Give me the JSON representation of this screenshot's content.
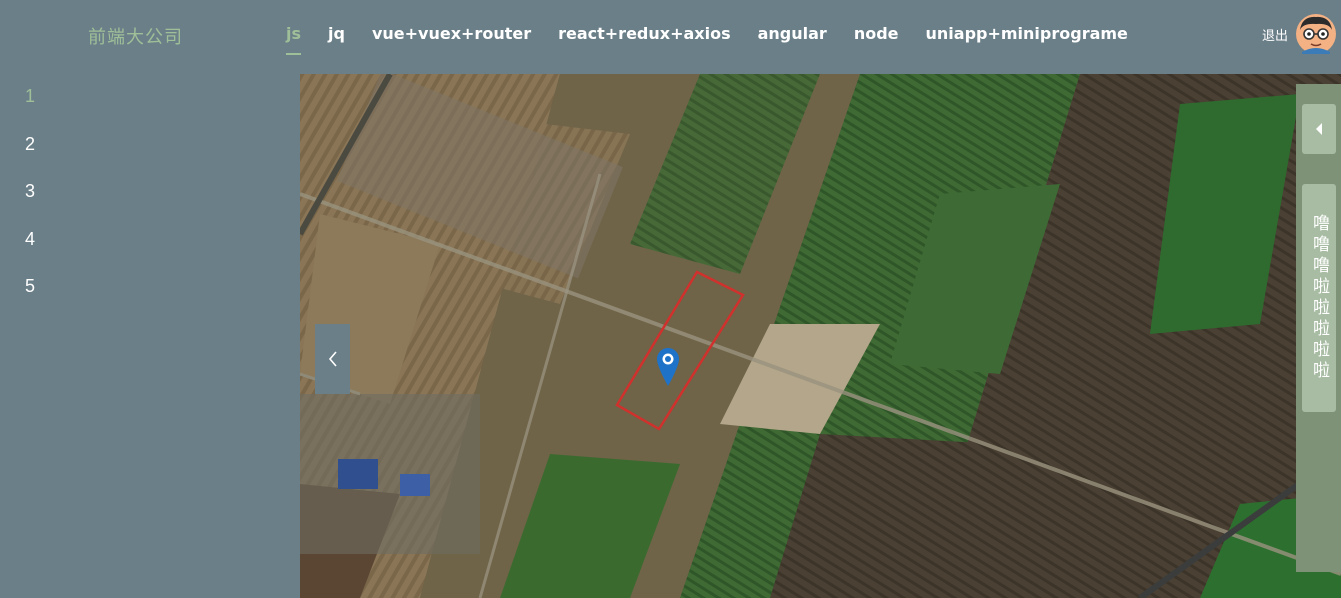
{
  "header": {
    "brand": "前端大公司",
    "nav": [
      {
        "label": "js",
        "active": true
      },
      {
        "label": "jq"
      },
      {
        "label": "vue+vuex+router"
      },
      {
        "label": "react+redux+axios"
      },
      {
        "label": "angular"
      },
      {
        "label": "node"
      },
      {
        "label": "uniapp+miniprograme"
      }
    ],
    "logout": "退出",
    "avatar_icon": "user-avatar-icon"
  },
  "sidebar": {
    "items": [
      {
        "label": "1",
        "active": true
      },
      {
        "label": "2"
      },
      {
        "label": "3"
      },
      {
        "label": "4"
      },
      {
        "label": "5"
      }
    ]
  },
  "map": {
    "prev_icon": "chevron-left-icon",
    "marker_icon": "map-pin-icon",
    "highlight_color": "#d0312d",
    "marker_color": "#1e72c7"
  },
  "drawer": {
    "toggle_icon": "caret-left-icon",
    "tab_label": "噜噜噜啦啦啦啦啦"
  },
  "colors": {
    "background": "#6b7f88",
    "accent": "#9fbf98",
    "drawer": "#7e9278",
    "drawer_button": "#a7bca3"
  }
}
